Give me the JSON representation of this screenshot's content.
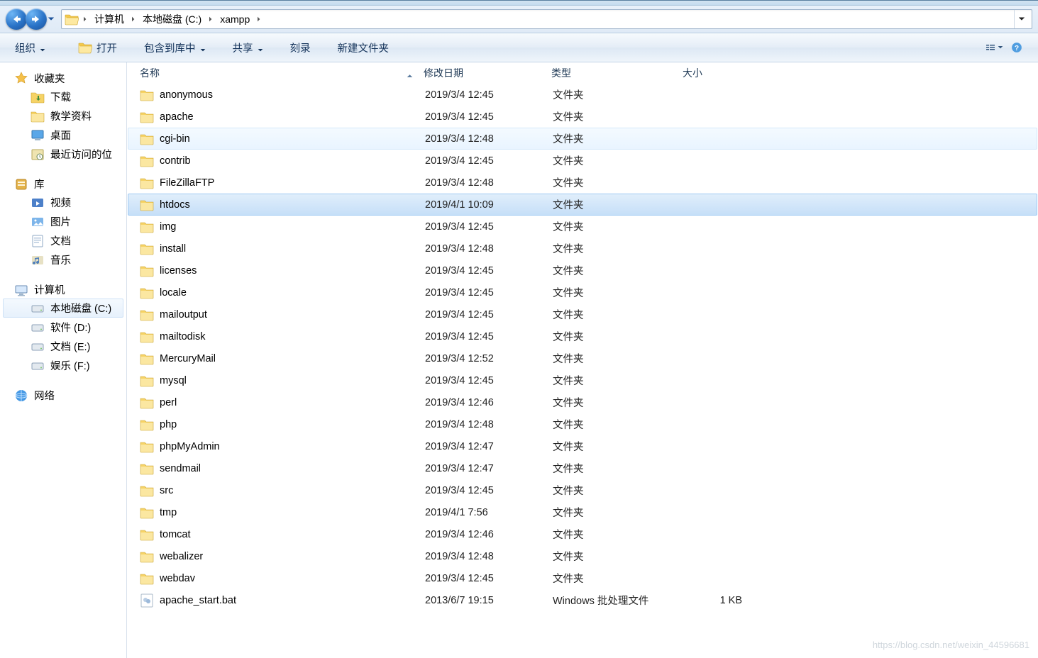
{
  "breadcrumb": {
    "items": [
      "计算机",
      "本地磁盘 (C:)",
      "xampp"
    ]
  },
  "toolbar": {
    "organize": "组织",
    "open": "打开",
    "include": "包含到库中",
    "share": "共享",
    "burn": "刻录",
    "newfolder": "新建文件夹"
  },
  "columns": {
    "name": "名称",
    "date": "修改日期",
    "type": "类型",
    "size": "大小"
  },
  "sidebar": {
    "fav": {
      "head": "收藏夹",
      "items": [
        "下载",
        "教学资料",
        "桌面",
        "最近访问的位"
      ]
    },
    "lib": {
      "head": "库",
      "items": [
        "视频",
        "图片",
        "文档",
        "音乐"
      ]
    },
    "comp": {
      "head": "计算机",
      "items": [
        "本地磁盘 (C:)",
        "软件 (D:)",
        "文档 (E:)",
        "娱乐 (F:)"
      ],
      "selected": 0
    },
    "net": {
      "head": "网络"
    }
  },
  "files": [
    {
      "name": "anonymous",
      "date": "2019/3/4 12:45",
      "type": "文件夹",
      "size": "",
      "icon": "folder"
    },
    {
      "name": "apache",
      "date": "2019/3/4 12:45",
      "type": "文件夹",
      "size": "",
      "icon": "folder"
    },
    {
      "name": "cgi-bin",
      "date": "2019/3/4 12:48",
      "type": "文件夹",
      "size": "",
      "icon": "folder",
      "state": "hov"
    },
    {
      "name": "contrib",
      "date": "2019/3/4 12:45",
      "type": "文件夹",
      "size": "",
      "icon": "folder"
    },
    {
      "name": "FileZillaFTP",
      "date": "2019/3/4 12:48",
      "type": "文件夹",
      "size": "",
      "icon": "folder"
    },
    {
      "name": "htdocs",
      "date": "2019/4/1 10:09",
      "type": "文件夹",
      "size": "",
      "icon": "folder",
      "state": "sel"
    },
    {
      "name": "img",
      "date": "2019/3/4 12:45",
      "type": "文件夹",
      "size": "",
      "icon": "folder"
    },
    {
      "name": "install",
      "date": "2019/3/4 12:48",
      "type": "文件夹",
      "size": "",
      "icon": "folder"
    },
    {
      "name": "licenses",
      "date": "2019/3/4 12:45",
      "type": "文件夹",
      "size": "",
      "icon": "folder"
    },
    {
      "name": "locale",
      "date": "2019/3/4 12:45",
      "type": "文件夹",
      "size": "",
      "icon": "folder"
    },
    {
      "name": "mailoutput",
      "date": "2019/3/4 12:45",
      "type": "文件夹",
      "size": "",
      "icon": "folder"
    },
    {
      "name": "mailtodisk",
      "date": "2019/3/4 12:45",
      "type": "文件夹",
      "size": "",
      "icon": "folder"
    },
    {
      "name": "MercuryMail",
      "date": "2019/3/4 12:52",
      "type": "文件夹",
      "size": "",
      "icon": "folder"
    },
    {
      "name": "mysql",
      "date": "2019/3/4 12:45",
      "type": "文件夹",
      "size": "",
      "icon": "folder"
    },
    {
      "name": "perl",
      "date": "2019/3/4 12:46",
      "type": "文件夹",
      "size": "",
      "icon": "folder"
    },
    {
      "name": "php",
      "date": "2019/3/4 12:48",
      "type": "文件夹",
      "size": "",
      "icon": "folder"
    },
    {
      "name": "phpMyAdmin",
      "date": "2019/3/4 12:47",
      "type": "文件夹",
      "size": "",
      "icon": "folder"
    },
    {
      "name": "sendmail",
      "date": "2019/3/4 12:47",
      "type": "文件夹",
      "size": "",
      "icon": "folder"
    },
    {
      "name": "src",
      "date": "2019/3/4 12:45",
      "type": "文件夹",
      "size": "",
      "icon": "folder"
    },
    {
      "name": "tmp",
      "date": "2019/4/1 7:56",
      "type": "文件夹",
      "size": "",
      "icon": "folder"
    },
    {
      "name": "tomcat",
      "date": "2019/3/4 12:46",
      "type": "文件夹",
      "size": "",
      "icon": "folder"
    },
    {
      "name": "webalizer",
      "date": "2019/3/4 12:48",
      "type": "文件夹",
      "size": "",
      "icon": "folder"
    },
    {
      "name": "webdav",
      "date": "2019/3/4 12:45",
      "type": "文件夹",
      "size": "",
      "icon": "folder"
    },
    {
      "name": "apache_start.bat",
      "date": "2013/6/7 19:15",
      "type": "Windows 批处理文件",
      "size": "1 KB",
      "icon": "bat"
    }
  ],
  "watermark": "https://blog.csdn.net/weixin_44596681"
}
